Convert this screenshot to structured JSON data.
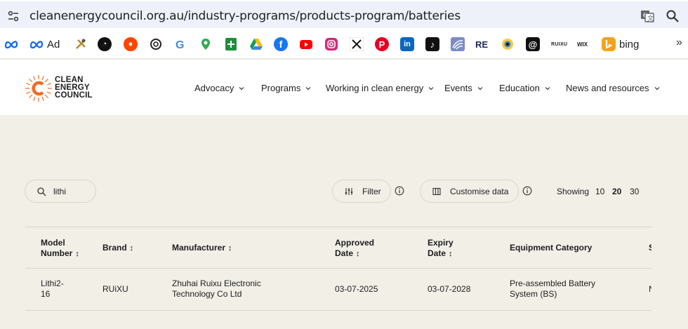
{
  "browser": {
    "url": "cleanenergycouncil.org.au/industry-programs/products-program/batteries",
    "bookmarks": [
      {
        "name": "meta-icon",
        "label": ""
      },
      {
        "name": "meta-ad-icon",
        "label": "Ad"
      },
      {
        "name": "tools-icon",
        "label": ""
      },
      {
        "name": "circle-logo-icon",
        "label": ""
      },
      {
        "name": "reddit-icon",
        "label": ""
      },
      {
        "name": "chatgpt-icon",
        "label": ""
      },
      {
        "name": "google-icon",
        "label": ""
      },
      {
        "name": "maps-icon",
        "label": ""
      },
      {
        "name": "sheets-icon",
        "label": ""
      },
      {
        "name": "drive-icon",
        "label": ""
      },
      {
        "name": "facebook-icon",
        "label": ""
      },
      {
        "name": "youtube-icon",
        "label": ""
      },
      {
        "name": "instagram-icon",
        "label": ""
      },
      {
        "name": "x-icon",
        "label": ""
      },
      {
        "name": "pinterest-icon",
        "label": ""
      },
      {
        "name": "linkedin-icon",
        "label": ""
      },
      {
        "name": "tiktok-icon",
        "label": ""
      },
      {
        "name": "wave-icon",
        "label": ""
      },
      {
        "name": "re-icon",
        "label": "RE"
      },
      {
        "name": "eye-icon",
        "label": ""
      },
      {
        "name": "threads-icon",
        "label": ""
      },
      {
        "name": "ruixu-icon",
        "label": "RUIXU"
      },
      {
        "name": "wix-icon",
        "label": "WIX"
      },
      {
        "name": "bing-icon",
        "label": "bing"
      }
    ]
  },
  "site": {
    "logo_lines": [
      "CLEAN",
      "ENERGY",
      "COUNCIL"
    ],
    "nav": [
      "Advocacy",
      "Programs",
      "Working in clean energy",
      "Events",
      "Education",
      "News and resources"
    ]
  },
  "controls": {
    "search_value": "lithi",
    "filter_label": "Filter",
    "customise_label": "Customise data",
    "showing_label": "Showing",
    "page_sizes": [
      "10",
      "20",
      "30"
    ],
    "selected_page_size": "20"
  },
  "table": {
    "headers": {
      "model_number_1": "Model",
      "model_number_2": "Number",
      "brand": "Brand",
      "manufacturer": "Manufacturer",
      "approved_1": "Approved",
      "approved_2": "Date",
      "expiry_1": "Expiry",
      "expiry_2": "Date",
      "category": "Equipment Category",
      "cut_off": "S"
    },
    "rows": [
      {
        "model_1": "Lithi2-",
        "model_2": "16",
        "brand": "RUiXU",
        "manufacturer_1": "Zhuhai Ruixu Electronic",
        "manufacturer_2": "Technology Co Ltd",
        "approved": "03-07-2025",
        "expiry": "03-07-2028",
        "category_1": "Pre-assembled Battery",
        "category_2": "System (BS)",
        "cut_off": "N"
      }
    ]
  },
  "colors": {
    "page_bg": "#f2efe7",
    "brand_orange": "#f26a21",
    "urlbar_bg": "#eef1fa"
  }
}
